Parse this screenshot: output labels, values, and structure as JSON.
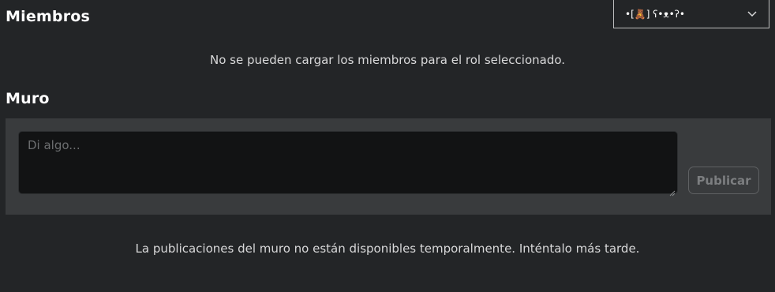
{
  "members": {
    "title": "Miembros",
    "role_dropdown": {
      "selected": "•[🧸] ʕ•ᴥ•ʔ•",
      "icon": "chevron-down-icon"
    },
    "error_message": "No se pueden cargar los miembros para el rol seleccionado."
  },
  "wall": {
    "title": "Muro",
    "input": {
      "value": "",
      "placeholder": "Di algo..."
    },
    "publish_label": "Publicar",
    "error_message": "La publicaciones del muro no están disponibles temporalmente. Inténtalo más tarde."
  },
  "colors": {
    "background": "#232527",
    "panel": "#393b3d",
    "input_background": "#121314",
    "text": "#ffffff",
    "muted_text": "#d8d8d9",
    "disabled_button_text": "#7c7e80"
  }
}
